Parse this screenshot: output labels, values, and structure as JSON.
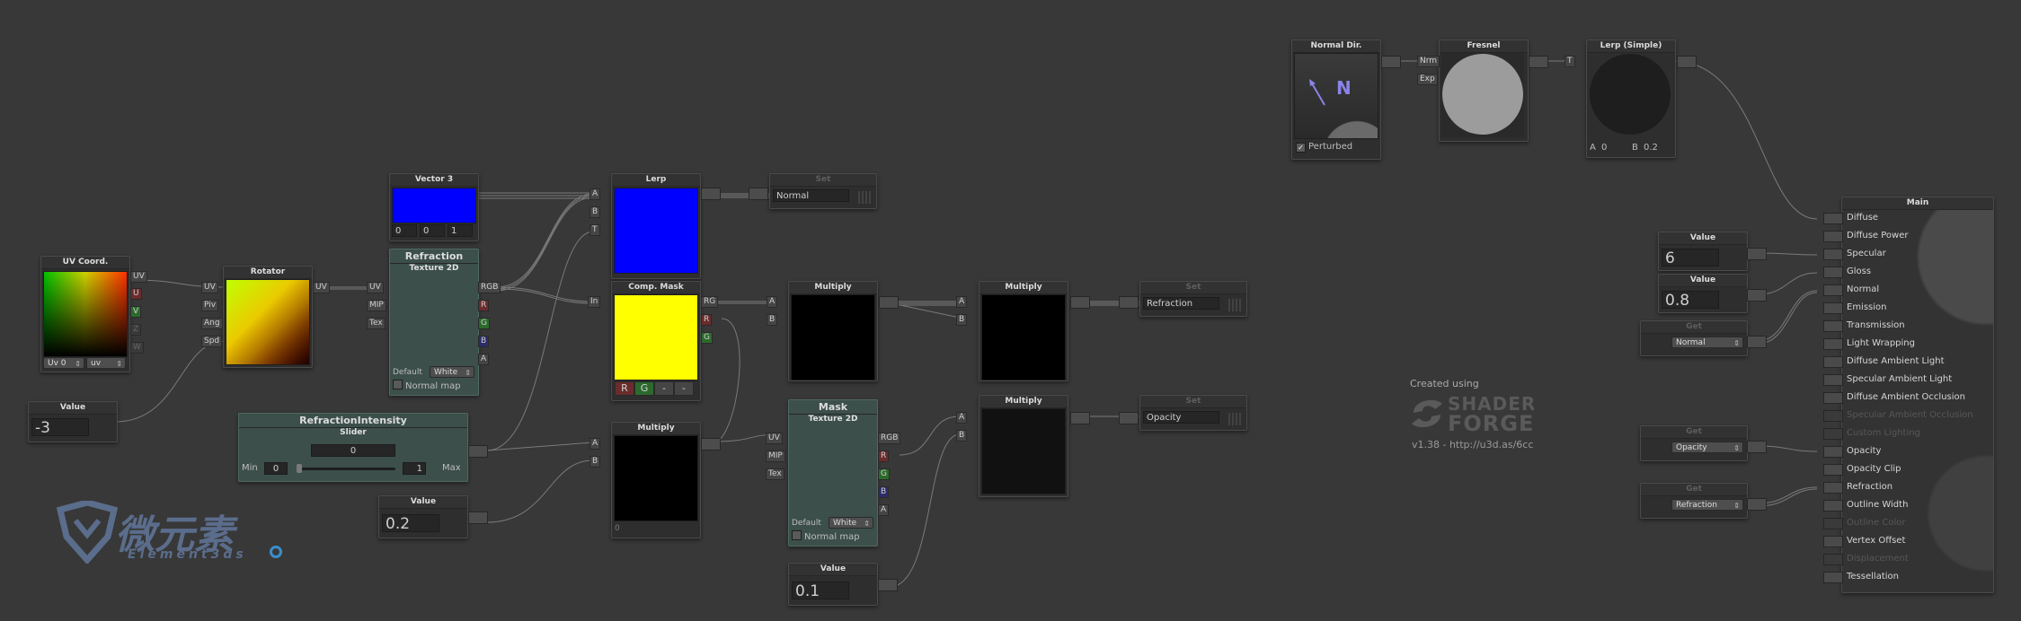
{
  "uv_coord": {
    "title": "UV Coord.",
    "uv_port": "UV",
    "u_port": "U",
    "v_port": "V",
    "z_port": "Z",
    "w_port": "W",
    "channel_value": "Uv 0",
    "name_value": "uv"
  },
  "value_neg3": {
    "title": "Value",
    "value": "-3"
  },
  "rotator": {
    "title": "Rotator",
    "inputs": [
      "UV",
      "Piv",
      "Ang",
      "Spd"
    ],
    "output": "UV"
  },
  "vector3": {
    "title": "Vector 3",
    "x": "0",
    "y": "0",
    "z": "1",
    "color": "#0000ff"
  },
  "refraction_tex": {
    "title": "Refraction",
    "subtitle": "Texture 2D",
    "inputs": [
      "UV",
      "MIP",
      "Tex"
    ],
    "outputs": [
      "RGB",
      "R",
      "G",
      "B",
      "A"
    ],
    "default_label": "Default",
    "default_value": "White",
    "normal_map_label": "Normal map"
  },
  "lerp": {
    "title": "Lerp",
    "inputs": [
      "A",
      "B",
      "T"
    ],
    "color": "#0000ff"
  },
  "set_normal": {
    "title": "Set",
    "value": "Normal"
  },
  "comp_mask": {
    "title": "Comp. Mask",
    "input": "In",
    "outputs": [
      "RG",
      "R",
      "G"
    ],
    "buttons": [
      "R",
      "G",
      "-",
      "-"
    ],
    "color": "#ffff00"
  },
  "multiply1": {
    "title": "Multiply",
    "inputs": [
      "A",
      "B"
    ]
  },
  "multiply2": {
    "title": "Multiply",
    "inputs": [
      "A",
      "B"
    ]
  },
  "set_refraction": {
    "title": "Set",
    "value": "Refraction"
  },
  "refraction_intensity": {
    "title": "RefractionIntensity",
    "subtitle": "Slider",
    "current": "0",
    "min_label": "Min",
    "min_value": "0",
    "max_value": "1",
    "max_label": "Max",
    "position": 0
  },
  "multiply3": {
    "title": "Multiply",
    "inputs": [
      "A",
      "B"
    ],
    "footer": "0"
  },
  "value_02": {
    "title": "Value",
    "value": "0.2"
  },
  "mask_tex": {
    "title": "Mask",
    "subtitle": "Texture 2D",
    "inputs": [
      "UV",
      "MIP",
      "Tex"
    ],
    "outputs": [
      "RGB",
      "R",
      "G",
      "B",
      "A"
    ],
    "default_label": "Default",
    "default_value": "White",
    "normal_map_label": "Normal map"
  },
  "multiply4": {
    "title": "Multiply",
    "inputs": [
      "A",
      "B"
    ]
  },
  "set_opacity": {
    "title": "Set",
    "value": "Opacity"
  },
  "value_01": {
    "title": "Value",
    "value": "0.1"
  },
  "normal_dir": {
    "title": "Normal Dir.",
    "glyph": "N",
    "perturbed_label": "Perturbed"
  },
  "fresnel": {
    "title": "Fresnel",
    "inputs": [
      "Nrm",
      "Exp"
    ]
  },
  "lerp_simple": {
    "title": "Lerp (Simple)",
    "input": "T",
    "a_label": "A",
    "a_value": "0",
    "b_label": "B",
    "b_value": "0.2"
  },
  "created": {
    "line1": "Created using",
    "brand1": "SHADER",
    "brand2": "FORGE",
    "version": "v1.38 - http://u3d.as/6cc"
  },
  "value_6": {
    "title": "Value",
    "value": "6"
  },
  "value_08": {
    "title": "Value",
    "value": "0.8"
  },
  "get_normal": {
    "title": "Get",
    "value": "Normal"
  },
  "get_opacity": {
    "title": "Get",
    "value": "Opacity"
  },
  "get_refraction": {
    "title": "Get",
    "value": "Refraction"
  },
  "main": {
    "title": "Main",
    "inputs": [
      {
        "label": "Diffuse",
        "enabled": true
      },
      {
        "label": "Diffuse Power",
        "enabled": true
      },
      {
        "label": "Specular",
        "enabled": true
      },
      {
        "label": "Gloss",
        "enabled": true
      },
      {
        "label": "Normal",
        "enabled": true
      },
      {
        "label": "Emission",
        "enabled": true
      },
      {
        "label": "Transmission",
        "enabled": true
      },
      {
        "label": "Light Wrapping",
        "enabled": true
      },
      {
        "label": "Diffuse Ambient Light",
        "enabled": true
      },
      {
        "label": "Specular Ambient Light",
        "enabled": true
      },
      {
        "label": "Diffuse Ambient Occlusion",
        "enabled": true
      },
      {
        "label": "Specular Ambient Occlusion",
        "enabled": false
      },
      {
        "label": "Custom Lighting",
        "enabled": false
      },
      {
        "label": "Opacity",
        "enabled": true
      },
      {
        "label": "Opacity Clip",
        "enabled": true
      },
      {
        "label": "Refraction",
        "enabled": true
      },
      {
        "label": "Outline Width",
        "enabled": true
      },
      {
        "label": "Outline Color",
        "enabled": false
      },
      {
        "label": "Vertex Offset",
        "enabled": true
      },
      {
        "label": "Displacement",
        "enabled": false
      },
      {
        "label": "Tessellation",
        "enabled": true
      }
    ]
  },
  "watermark": {
    "cn": "微元素",
    "en": "Element3ds"
  }
}
